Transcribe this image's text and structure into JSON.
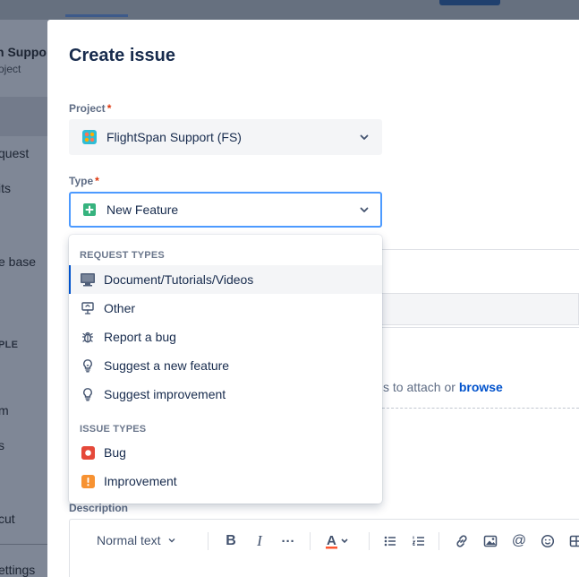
{
  "background": {
    "sidebar": {
      "project_name": "n Suppo",
      "project_sub": "oject",
      "items": [
        "quest",
        "its",
        "e base",
        "m",
        "s",
        "cut",
        "ettings"
      ],
      "section_caption": "PLE"
    }
  },
  "modal": {
    "title": "Create issue",
    "project": {
      "label": "Project",
      "required_mark": "*",
      "value": "FlightSpan Support (FS)",
      "icon": "project-avatar-icon"
    },
    "type": {
      "label": "Type",
      "required_mark": "*",
      "value": "New Feature",
      "icon": "new-feature-icon"
    },
    "attachment": {
      "text": "s to attach or",
      "link": "browse"
    },
    "description": {
      "label": "Description",
      "toolbar": {
        "text_style": "Normal text",
        "buttons": [
          "bold-icon",
          "italic-icon",
          "more-icon",
          "text-color-icon",
          "bullet-list-icon",
          "numbered-list-icon",
          "link-icon",
          "image-icon",
          "mention-icon",
          "emoji-icon",
          "table-icon"
        ]
      }
    }
  },
  "dropdown": {
    "groups": [
      {
        "heading": "REQUEST TYPES",
        "items": [
          {
            "label": "Document/Tutorials/Videos",
            "icon": "monitor-icon",
            "active": true
          },
          {
            "label": "Other",
            "icon": "presentation-icon"
          },
          {
            "label": "Report a bug",
            "icon": "bug-outline-icon"
          },
          {
            "label": "Suggest a new feature",
            "icon": "lightbulb-icon"
          },
          {
            "label": "Suggest improvement",
            "icon": "lightbulb-icon"
          }
        ]
      },
      {
        "heading": "ISSUE TYPES",
        "items": [
          {
            "label": "Bug",
            "icon": "bug-icon"
          },
          {
            "label": "Improvement",
            "icon": "improvement-icon"
          }
        ]
      }
    ]
  },
  "colors": {
    "accent": "#0052cc",
    "focus_border": "#4c9aff",
    "required": "#de350b",
    "new_feature": "#36b37e",
    "bug": "#e5493a",
    "improvement": "#f79232"
  }
}
